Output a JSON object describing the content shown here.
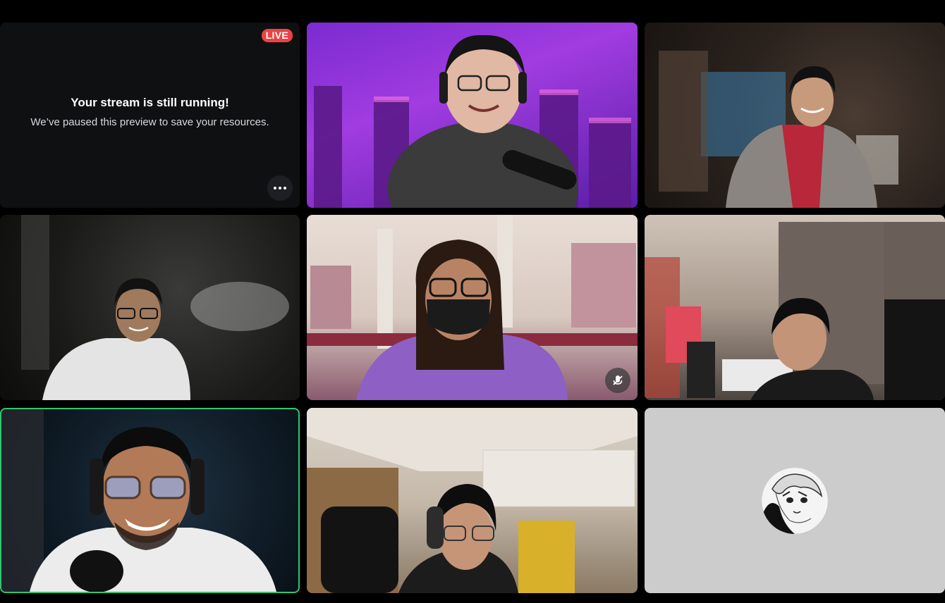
{
  "stream_preview": {
    "live_label": "LIVE",
    "title": "Your stream is still running!",
    "subtitle": "We’ve paused this preview to save your resources.",
    "more_icon": "more-horizontal-icon"
  },
  "participants": [
    {
      "tile": 2,
      "state": "video"
    },
    {
      "tile": 3,
      "state": "video"
    },
    {
      "tile": 4,
      "state": "video"
    },
    {
      "tile": 5,
      "state": "video",
      "muted": true,
      "mute_icon": "mic-off-icon"
    },
    {
      "tile": 6,
      "state": "video"
    },
    {
      "tile": 7,
      "state": "video",
      "speaking": true
    },
    {
      "tile": 8,
      "state": "video"
    },
    {
      "tile": 9,
      "state": "avatar",
      "avatar_icon": "user-avatar"
    }
  ],
  "colors": {
    "live": "#ed4245",
    "speaking_border": "#2dc770",
    "tile_background": "#0f1012",
    "avatar_tile_background": "#cccccc"
  }
}
